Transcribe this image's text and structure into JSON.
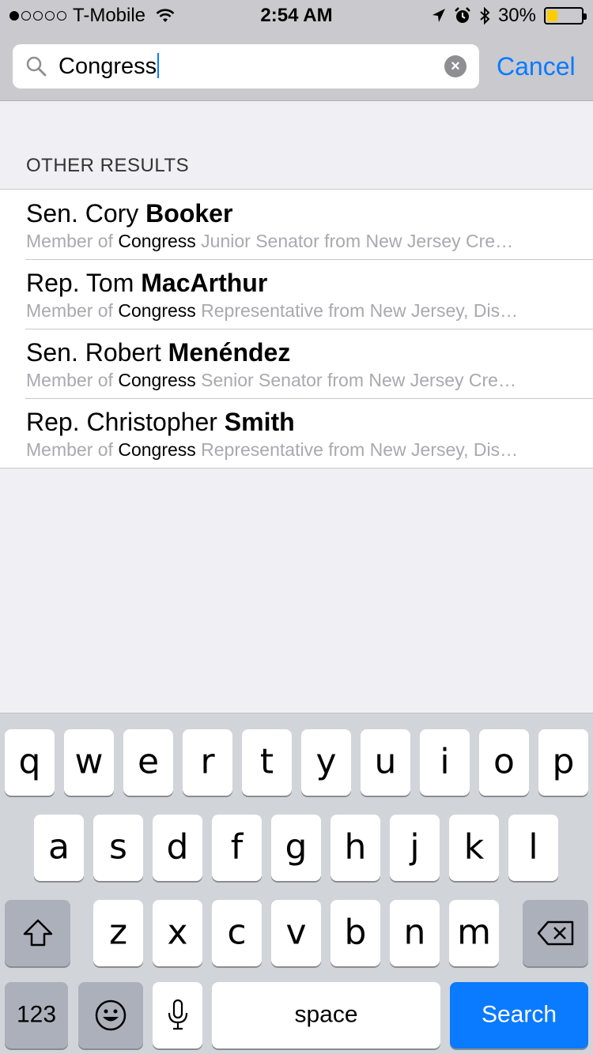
{
  "status_bar": {
    "carrier": "T-Mobile",
    "time": "2:54 AM",
    "battery_percent": "30%",
    "battery_level": 0.3
  },
  "search": {
    "query": "Congress",
    "cancel_label": "Cancel"
  },
  "section_header": "OTHER RESULTS",
  "results": [
    {
      "title_prefix": "Sen. Cory ",
      "title_bold": "Booker",
      "sub_prefix": "Member of ",
      "sub_highlight": "Congress",
      "sub_rest": " Junior Senator from New Jersey  Cre…"
    },
    {
      "title_prefix": "Rep. Tom ",
      "title_bold": "MacArthur",
      "sub_prefix": "Member of ",
      "sub_highlight": "Congress",
      "sub_rest": " Representative from New Jersey, Dis…"
    },
    {
      "title_prefix": "Sen. Robert ",
      "title_bold": "Menéndez",
      "sub_prefix": "Member of ",
      "sub_highlight": "Congress",
      "sub_rest": " Senior Senator from New Jersey  Cre…"
    },
    {
      "title_prefix": "Rep. Christopher ",
      "title_bold": "Smith",
      "sub_prefix": "Member of ",
      "sub_highlight": "Congress",
      "sub_rest": " Representative from New Jersey, Dis…"
    }
  ],
  "keyboard": {
    "row1": [
      "q",
      "w",
      "e",
      "r",
      "t",
      "y",
      "u",
      "i",
      "o",
      "p"
    ],
    "row2": [
      "a",
      "s",
      "d",
      "f",
      "g",
      "h",
      "j",
      "k",
      "l"
    ],
    "row3": [
      "z",
      "x",
      "c",
      "v",
      "b",
      "n",
      "m"
    ],
    "numbers_label": "123",
    "space_label": "space",
    "search_label": "Search"
  },
  "colors": {
    "accent": "#0a7aff",
    "battery": "#ffcc00"
  }
}
